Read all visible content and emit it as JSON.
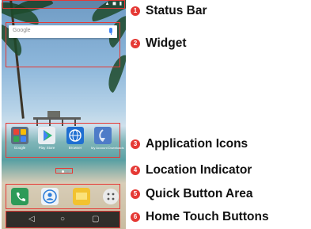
{
  "widget": {
    "search_placeholder": "Google"
  },
  "apps": [
    {
      "label": "Google",
      "color": "#5b6e83"
    },
    {
      "label": "Play Store",
      "color": "#e9eef2"
    },
    {
      "label": "Browser",
      "color": "#1f6fd1"
    },
    {
      "label": "My Account Downloads",
      "color": "#4e7cc8"
    }
  ],
  "quick_buttons": [
    {
      "icon": "phone-icon",
      "color": "#2e9a58"
    },
    {
      "icon": "contacts-icon",
      "color": "#2f7ed8"
    },
    {
      "icon": "messaging-icon",
      "color": "#f2c230"
    },
    {
      "icon": "apps-icon",
      "color": "#3a3a3a"
    }
  ],
  "home_buttons": [
    "back-icon",
    "home-icon",
    "recents-icon"
  ],
  "callouts": [
    {
      "number": "1",
      "label": "Status Bar"
    },
    {
      "number": "2",
      "label": "Widget"
    },
    {
      "number": "3",
      "label": "Application Icons"
    },
    {
      "number": "4",
      "label": "Location Indicator"
    },
    {
      "number": "5",
      "label": "Quick Button Area"
    },
    {
      "number": "6",
      "label": "Home Touch Buttons"
    }
  ],
  "colors": {
    "accent": "#e53935"
  }
}
